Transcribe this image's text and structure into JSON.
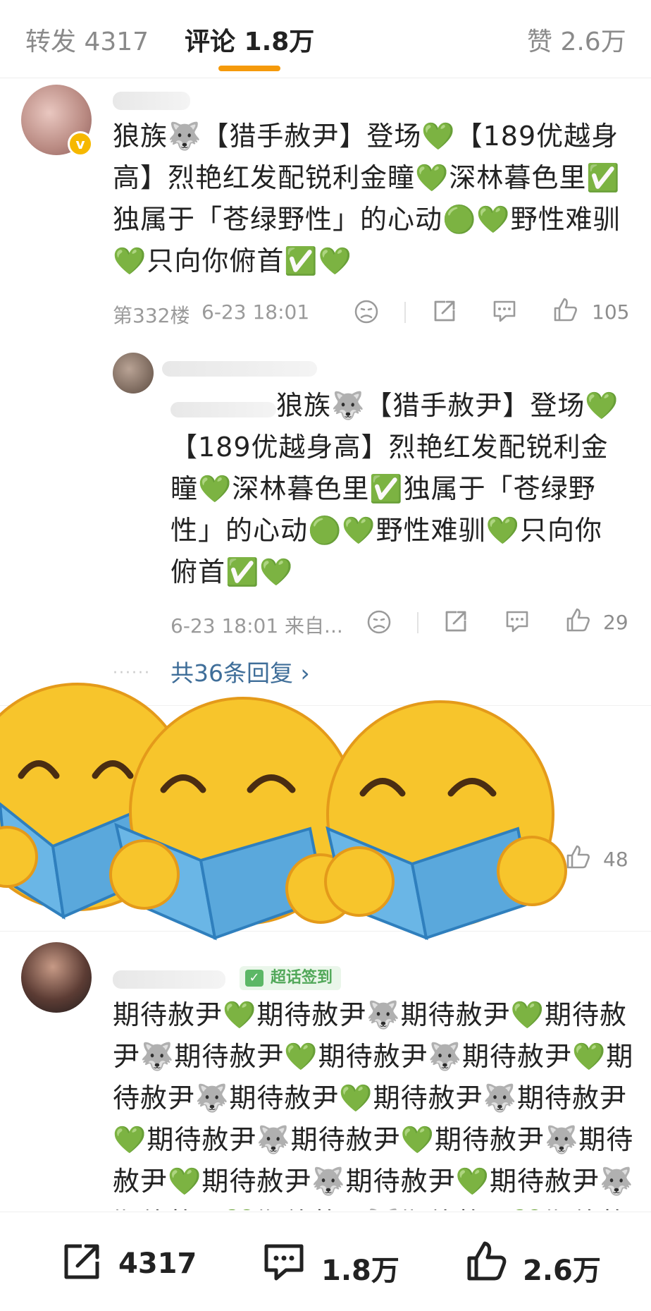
{
  "tabs": {
    "repost": "转发 4317",
    "comments": "评论 1.8万",
    "likes": "赞 2.6万"
  },
  "comment1": {
    "text": "狼族🐺【猎手赦尹】登场💚【189优越身高】烈艳红发配锐利金瞳💚深林暮色里✅独属于「苍绿野性」的心动🟢💚野性难驯💚只向你俯首✅💚",
    "floor": "第332楼",
    "time": "6-23 18:01",
    "like_count": "105"
  },
  "reply1": {
    "text_prefix": "：",
    "text": "狼族🐺【猎手赦尹】登场💚【189优越身高】烈艳红发配锐利金瞳💚深林暮色里✅独属于「苍绿野性」的心动🟢💚野性难驯💚只向你俯首✅💚",
    "time_source": "6-23 18:01 来自...",
    "like_count": "29"
  },
  "more_replies": "共36条回复 ›",
  "hidden_comment": {
    "like_count": "48"
  },
  "comment3": {
    "badge": "超话签到",
    "text": "期待赦尹💚期待赦尹🐺期待赦尹💚期待赦尹🐺期待赦尹💚期待赦尹🐺期待赦尹💚期待赦尹🐺期待赦尹💚期待赦尹🐺期待赦尹💚期待赦尹🐺期待赦尹💚期待赦尹🐺期待赦尹💚期待赦尹🐺期待赦尹💚期待赦尹🐺期待赦尹💚期待赦尹🐺期待赦尹💚期待赦尹🐺"
  },
  "bottom_bar": {
    "repost": "4317",
    "comment": "1.8万",
    "like": "2.6万"
  },
  "colors": {
    "accent": "#f59a0b",
    "link": "#3f6e99",
    "text": "#222222",
    "muted": "#9a9a9a"
  }
}
